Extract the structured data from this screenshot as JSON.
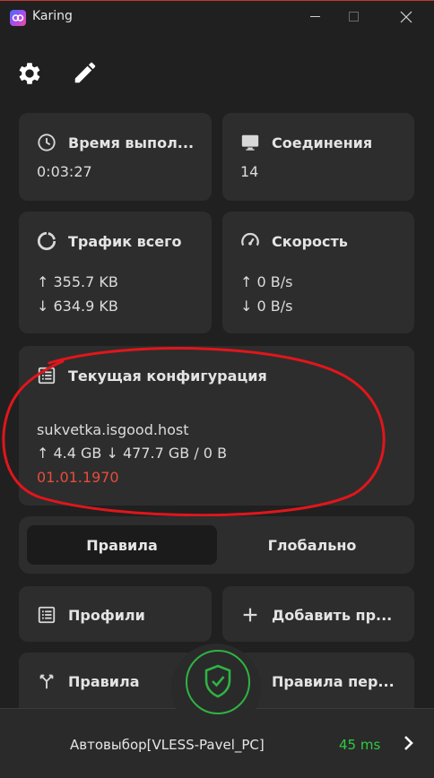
{
  "window": {
    "title": "Karing"
  },
  "toolbar": {
    "settings_icon": "gear-icon",
    "edit_icon": "pencil-icon"
  },
  "cards": {
    "uptime": {
      "title": "Время выпол...",
      "value": "0:03:27"
    },
    "connections": {
      "title": "Соединения",
      "value": "14"
    },
    "traffic": {
      "title": "Трафик всего",
      "up": "↑ 355.7 KB",
      "down": "↓ 634.9 KB"
    },
    "speed": {
      "title": "Скорость",
      "up": "↑ 0 B/s",
      "down": "↓ 0 B/s"
    },
    "config": {
      "title": "Текущая конфигурация",
      "host": "sukvetka.isgood.host",
      "usage": "↑ 4.4 GB ↓ 477.7 GB / 0 B",
      "date": "01.01.1970"
    }
  },
  "mode": {
    "rules": "Правила",
    "global": "Глобально",
    "selected": "rules"
  },
  "actions": {
    "profiles": "Профили",
    "add_profile": "Добавить пр...",
    "rules": "Правила",
    "rules_other": "Правила пер..."
  },
  "bottom": {
    "server": "Автовыбор[VLESS-Pavel_PC]",
    "latency": "45 ms"
  },
  "colors": {
    "accent_green": "#2fb344",
    "alert_red": "#e74c3c",
    "latency_green": "#2ecc40"
  }
}
